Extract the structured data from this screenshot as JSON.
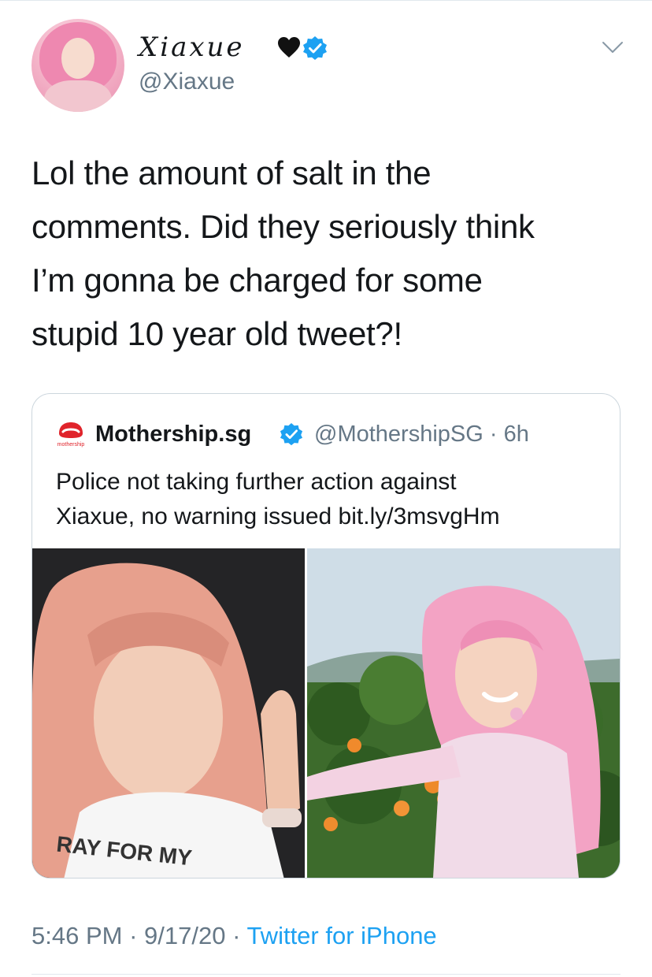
{
  "tweet": {
    "display_name": "Xiaxue",
    "handle": "@Xiaxue",
    "text": "Lol the amount of salt in the\ncomments. Did they seriously think\nI’m gonna be charged for some\nstupid 10 year old tweet?!",
    "time": "5:46 PM",
    "date": "9/17/20",
    "separator": " · ",
    "source": "Twitter for iPhone"
  },
  "quoted": {
    "name": "Mothership.sg",
    "handle": "@MothershipSG",
    "age": "6h",
    "separator": " · ",
    "text": "Police not taking further action against\nXiaxue, no warning issued bit.ly/3msvgHm",
    "logo_text": "mothership"
  },
  "images": {
    "left_shirt_text": "RAY FOR MY"
  },
  "colors": {
    "text": "#14171a",
    "secondary": "#657786",
    "link": "#1da1f2",
    "border": "#ccd6dd",
    "logo_red": "#e0242b"
  },
  "icons": [
    "heart-icon",
    "verified-icon",
    "chevron-down-icon"
  ]
}
